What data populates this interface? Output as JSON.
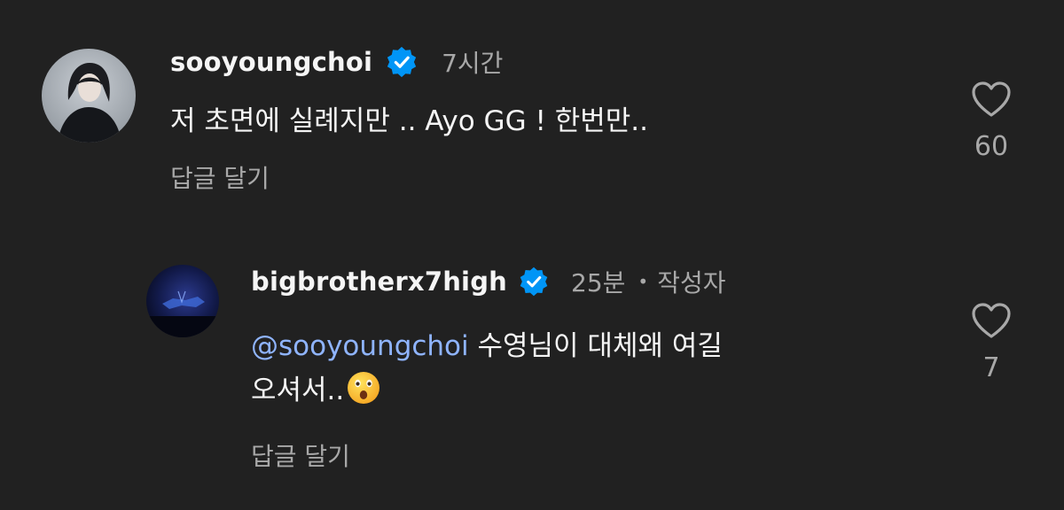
{
  "colors": {
    "background": "#212121",
    "primary_text": "#f5f5f5",
    "secondary_text": "#a8a8a8",
    "mention": "#8fb4ff",
    "verified_badge": "#0095f6"
  },
  "comments": [
    {
      "username": "sooyoungchoi",
      "verified": true,
      "time": "7시간",
      "text": "저 초면에 실례지만 .. Ayo GG ! 한번만..",
      "reply_label": "답글 달기",
      "like_count": "60",
      "icons": {
        "avatar": "profile-photo",
        "like": "heart-outline-icon",
        "badge": "verified-badge-icon"
      }
    },
    {
      "username": "bigbrotherx7high",
      "verified": true,
      "time": "25분",
      "separator": "•",
      "author_label": "작성자",
      "mention": "@sooyoungchoi",
      "text_line1": "수영님이 대체왜 여길",
      "text_line2": "오셔서..",
      "emoji": "😮",
      "reply_label": "답글 달기",
      "like_count": "7",
      "icons": {
        "avatar": "profile-photo",
        "like": "heart-outline-icon",
        "badge": "verified-badge-icon",
        "emoji": "astonished-face-emoji"
      }
    }
  ]
}
